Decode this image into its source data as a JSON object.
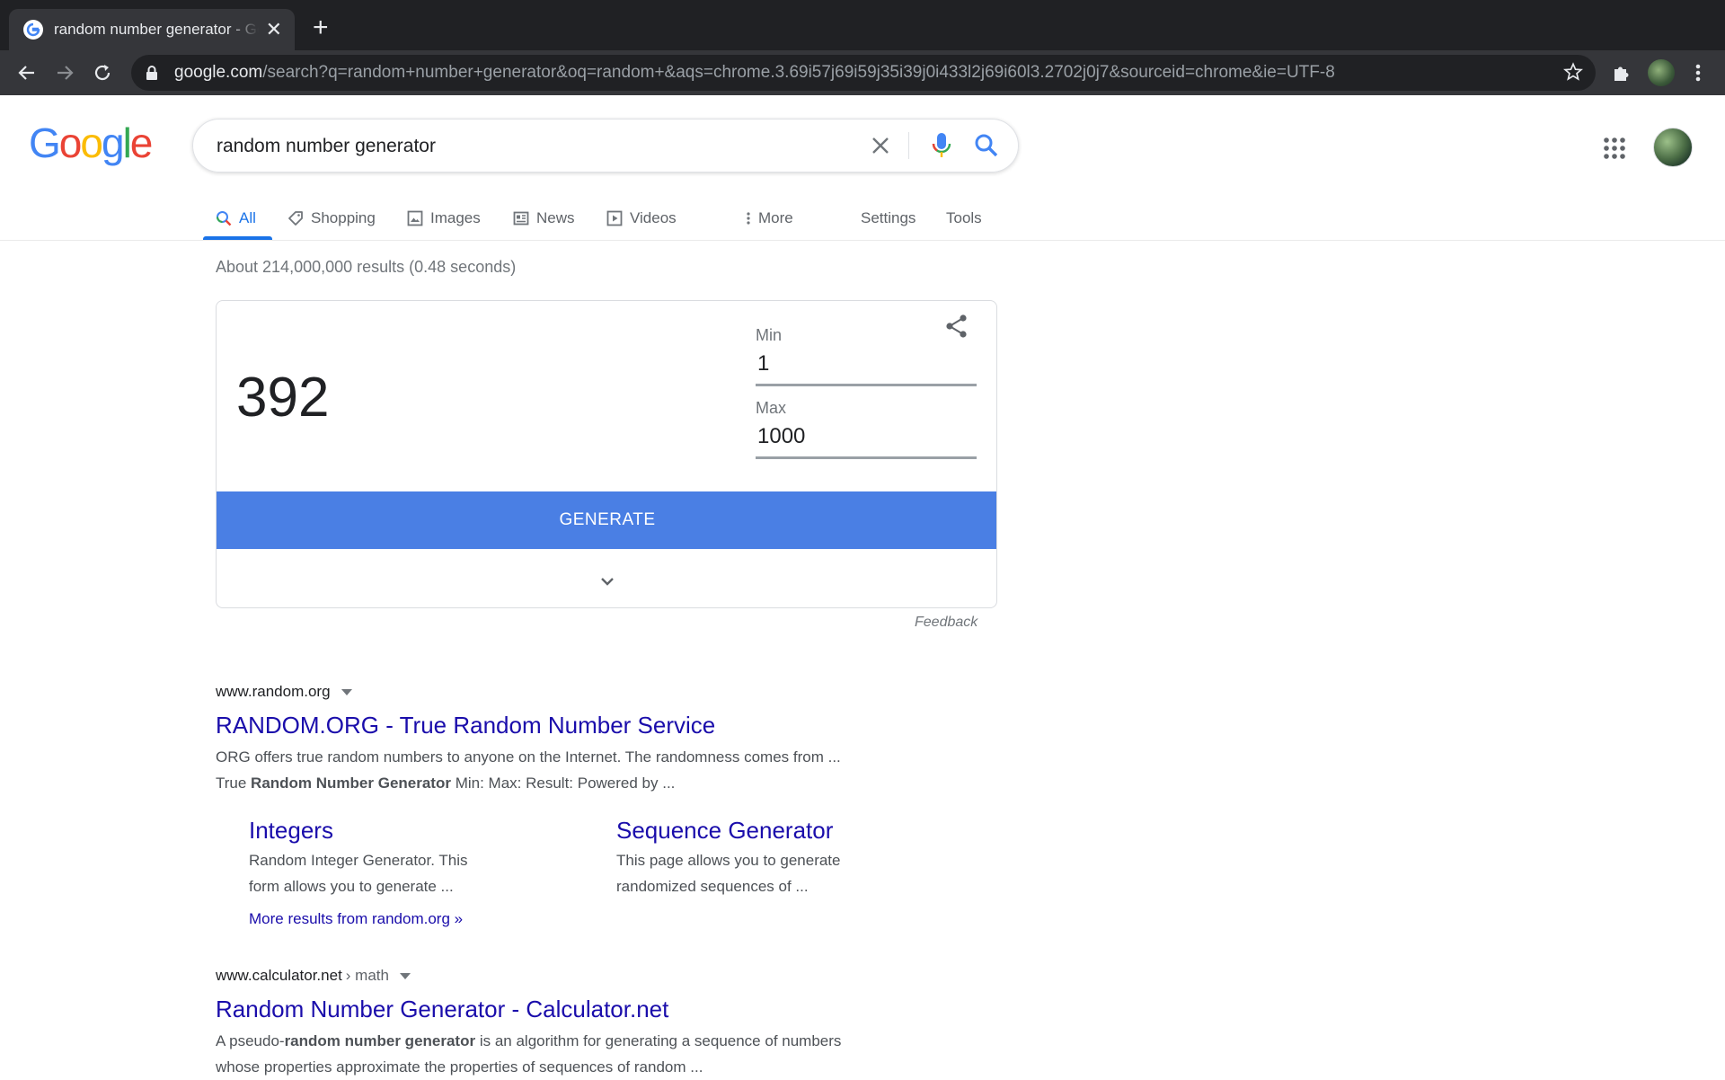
{
  "browser": {
    "tab_title": "random number generator - Google Search",
    "url_host": "google.com",
    "url_rest": "/search?q=random+number+generator&oq=random+&aqs=chrome.3.69i57j69i59j35i39j0i433l2j69i60l3.2702j0j7&sourceid=chrome&ie=UTF-8"
  },
  "search": {
    "logo": [
      "G",
      "o",
      "o",
      "g",
      "l",
      "e"
    ],
    "logo_colors": [
      "#4285f4",
      "#ea4335",
      "#fbbc05",
      "#4285f4",
      "#34a853",
      "#ea4335"
    ],
    "query": "random number generator"
  },
  "nav": {
    "all": "All",
    "shopping": "Shopping",
    "images": "Images",
    "news": "News",
    "videos": "Videos",
    "more": "More",
    "settings": "Settings",
    "tools": "Tools"
  },
  "stats": "About 214,000,000 results (0.48 seconds)",
  "rng": {
    "result": "392",
    "min_label": "Min",
    "min_value": "1",
    "max_label": "Max",
    "max_value": "1000",
    "generate_label": "GENERATE",
    "feedback": "Feedback"
  },
  "results": [
    {
      "cite": "www.random.org",
      "crumb": "",
      "title": "RANDOM.ORG - True Random Number Service",
      "snippet_line1": "ORG offers true random numbers to anyone on the Internet. The randomness comes from ...",
      "snippet_line2_pre": "True ",
      "snippet_line2_bold": "Random Number Generator",
      "snippet_line2_post": " Min: Max: Result: Powered by ...",
      "sitelinks": [
        {
          "title": "Integers",
          "line1": "Random Integer Generator. This",
          "line2": "form allows you to generate ..."
        },
        {
          "title": "Sequence Generator",
          "line1": "This page allows you to generate",
          "line2": "randomized sequences of ..."
        }
      ],
      "more_results": "More results from random.org »"
    },
    {
      "cite": "www.calculator.net",
      "crumb": "› math",
      "title": "Random Number Generator - Calculator.net",
      "snippet_line1_pre": "A pseudo-",
      "snippet_line1_bold": "random number generator",
      "snippet_line1_post": " is an algorithm for generating a sequence of numbers",
      "snippet_line2": "whose properties approximate the properties of sequences of random ..."
    }
  ]
}
